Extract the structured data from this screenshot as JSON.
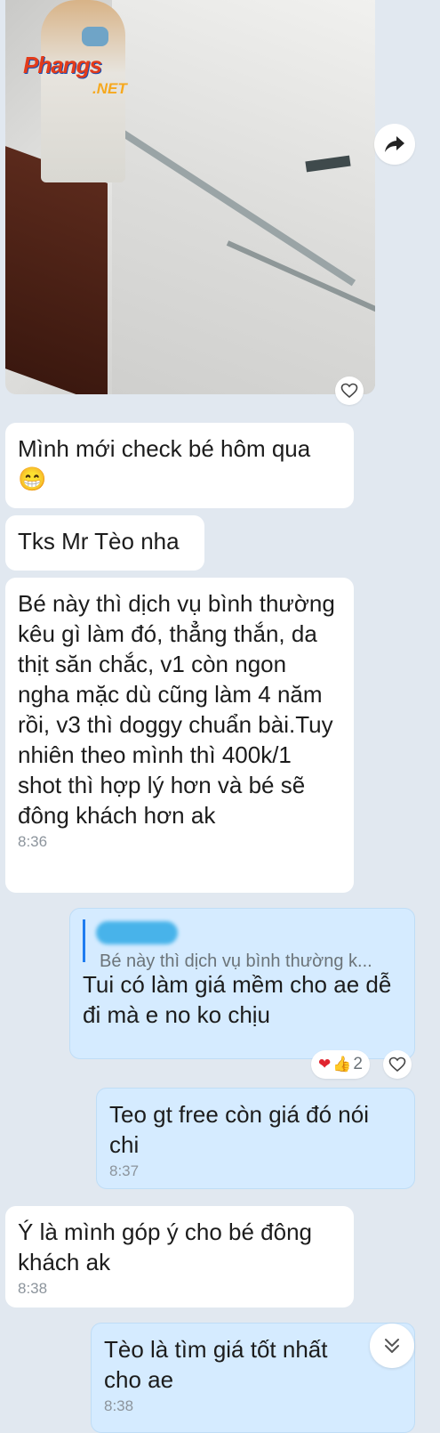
{
  "photo": {
    "watermark_main": "Phangs",
    "watermark_sub": ".NET"
  },
  "messages": [
    {
      "id": "m1",
      "text": "Mình mới check bé hôm qua 😁",
      "time": ""
    },
    {
      "id": "m2",
      "text": "Tks Mr Tèo nha",
      "time": ""
    },
    {
      "id": "m3",
      "text": "Bé này thì dịch vụ bình thường kêu gì làm đó, thẳng thắn, da thịt săn chắc, v1 còn ngon ngha mặc dù cũng làm 4 năm rồi, v3 thì doggy chuẩn bài.Tuy nhiên theo mình thì 400k/1 shot thì hợp lý hơn và bé sẽ đông khách hơn ak",
      "time": "8:36"
    },
    {
      "id": "m4",
      "quote": "Bé này thì dịch vụ bình thường k...",
      "text": "Tui có làm giá mềm cho ae dễ đi mà e no ko chịu",
      "reaction_count": "2"
    },
    {
      "id": "m5",
      "text": "Teo gt free còn giá đó nói chi",
      "time": "8:37"
    },
    {
      "id": "m6",
      "text": "Ý là mình góp ý cho bé đông khách ak",
      "time": "8:38"
    },
    {
      "id": "m7",
      "text": "Tèo là tìm giá tốt nhất cho ae",
      "time": "8:38"
    }
  ],
  "colors": {
    "background": "#e1e8f0",
    "incoming": "#ffffff",
    "outgoing": "#d5ebff",
    "accent": "#1f7cf0"
  },
  "icons": {
    "share": "share-arrow-icon",
    "like": "heart-outline-icon",
    "scroll": "double-chevron-down-icon",
    "reactions": [
      "heart-emoji",
      "thumbs-up-emoji"
    ]
  }
}
